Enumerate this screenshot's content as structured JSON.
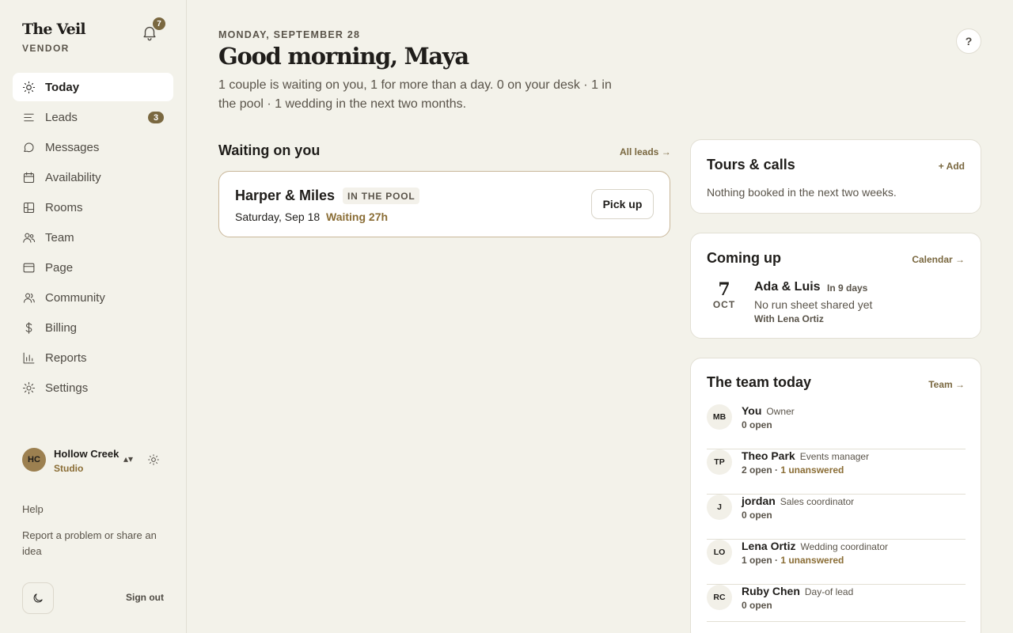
{
  "brand": {
    "name": "The Veil",
    "subtitle": "VENDOR"
  },
  "notifications": {
    "count": "7",
    "icon": "bell-icon"
  },
  "nav": [
    {
      "label": "Today",
      "icon": "sun-icon",
      "active": true
    },
    {
      "label": "Leads",
      "icon": "list-icon",
      "badge": "3"
    },
    {
      "label": "Messages",
      "icon": "chat-icon"
    },
    {
      "label": "Availability",
      "icon": "calendar-icon"
    },
    {
      "label": "Rooms",
      "icon": "floorplan-icon"
    },
    {
      "label": "Team",
      "icon": "users-icon"
    },
    {
      "label": "Page",
      "icon": "browser-icon"
    },
    {
      "label": "Community",
      "icon": "community-icon"
    },
    {
      "label": "Billing",
      "icon": "dollar-icon"
    },
    {
      "label": "Reports",
      "icon": "bar-chart-icon"
    },
    {
      "label": "Settings",
      "icon": "gear-icon"
    }
  ],
  "account": {
    "initials": "HC",
    "name": "Hollow Creek",
    "role": "Studio",
    "switch_glyph": "▴▾"
  },
  "footer": {
    "help": "Help",
    "report": "Report a problem or share an idea",
    "sign_out": "Sign out"
  },
  "header": {
    "date": "MONDAY, SEPTEMBER 28",
    "greeting": "Good morning, Maya",
    "summary": "1 couple is waiting on you, 1 for more than a day. 0 on your desk · 1 in the pool · 1 wedding in the next two months.",
    "help_label": "?"
  },
  "waiting": {
    "title": "Waiting on you",
    "link": "All leads →",
    "leads": [
      {
        "names": "Harper & Miles",
        "tag": "IN THE POOL",
        "date": "Saturday, Sep 18",
        "waiting": "Waiting 27h",
        "action": "Pick up"
      }
    ]
  },
  "tours": {
    "title": "Tours & calls",
    "link": "+ Add",
    "empty": "Nothing booked in the next two weeks."
  },
  "coming_up": {
    "title": "Coming up",
    "link": "Calendar →",
    "events": [
      {
        "day": "7",
        "month": "OCT",
        "names": "Ada & Luis",
        "when": "In 9 days",
        "note": "No run sheet shared yet",
        "with": "With Lena Ortiz"
      }
    ]
  },
  "team_today": {
    "title": "The team today",
    "link": "Team →",
    "members": [
      {
        "initials": "MB",
        "name": "You",
        "role": "Owner",
        "open": "0 open",
        "unanswered": ""
      },
      {
        "initials": "TP",
        "name": "Theo Park",
        "role": "Events manager",
        "open": "2 open",
        "unanswered": "1 unanswered"
      },
      {
        "initials": "J",
        "name": "jordan",
        "role": "Sales coordinator",
        "open": "0 open",
        "unanswered": ""
      },
      {
        "initials": "LO",
        "name": "Lena Ortiz",
        "role": "Wedding coordinator",
        "open": "1 open",
        "unanswered": "1 unanswered"
      },
      {
        "initials": "RC",
        "name": "Ruby Chen",
        "role": "Day-of lead",
        "open": "0 open",
        "unanswered": ""
      }
    ]
  },
  "colors": {
    "accent": "#7a6840",
    "background": "#f3f2ea",
    "card": "#ffffff",
    "highlight": "#8a6d35"
  }
}
